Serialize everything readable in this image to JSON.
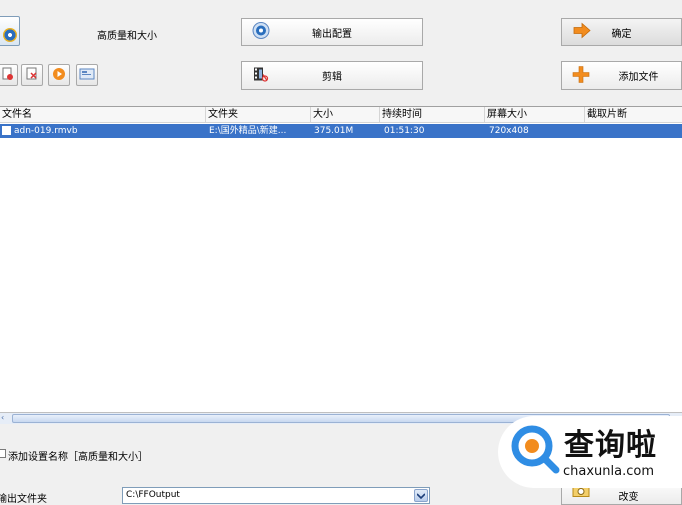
{
  "toolbar": {
    "profile_label": "高质量和大小",
    "output_config_label": "输出配置",
    "clip_label": "剪辑",
    "ok_label": "确定",
    "add_file_label": "添加文件"
  },
  "table": {
    "columns": [
      "文件名",
      "文件夹",
      "大小",
      "持续时间",
      "屏幕大小",
      "截取片断"
    ],
    "rows": [
      {
        "name": "adn-019.rmvb",
        "folder": "E:\\国外精品\\新建...",
        "size": "375.01M",
        "duration": "01:51:30",
        "screen": "720x408",
        "clip": ""
      }
    ]
  },
  "options": {
    "add_setting_name_label": "添加设置名称［高质量和大小］",
    "output_folder_label": "输出文件夹",
    "output_folder_value": "C:\\FFOutput",
    "change_label": "改变"
  },
  "watermark": {
    "logo_text": "查询啦",
    "url": "chaxunla.com"
  },
  "colors": {
    "selected_row": "#3a73c8",
    "accent_orange": "#f28c1e",
    "watermark_blue": "#2f8de4"
  }
}
